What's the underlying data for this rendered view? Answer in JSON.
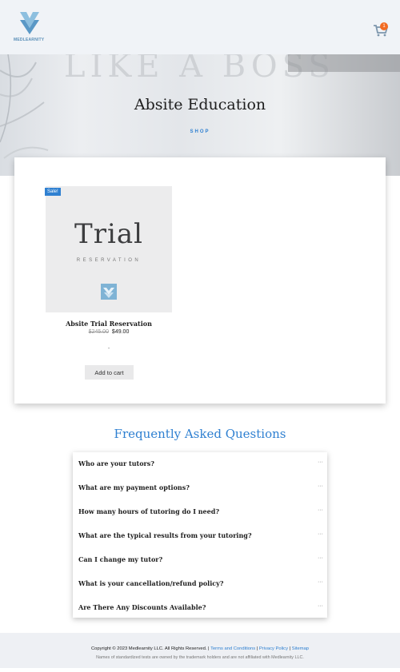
{
  "header": {
    "logo_text": "MEDLEARNITY",
    "cart_count": "1",
    "cart_icon": "shopping-cart-icon",
    "logo_icon": "medlearnity-logo-icon"
  },
  "hero": {
    "background_text": "LIKE A BOSS",
    "title": "Absite Education",
    "breadcrumb": "SHOP"
  },
  "product": {
    "sale_badge": "Sale!",
    "image_title": "Trial",
    "image_subtitle": "RESERVATION",
    "name": "Absite Trial Reservation",
    "old_price": "$245.00",
    "price": "$49.00",
    "separator": "-",
    "add_to_cart": "Add to cart"
  },
  "faq": {
    "title": "Frequently Asked Questions",
    "toggle_glyph": "···",
    "items": [
      {
        "question": "Who are your tutors?"
      },
      {
        "question": "What are my payment options?"
      },
      {
        "question": "How many hours of tutoring do I need?"
      },
      {
        "question": "What are the typical results from your tutoring?"
      },
      {
        "question": "Can I change my tutor?"
      },
      {
        "question": "What is your cancellation/refund policy?"
      },
      {
        "question": "Are There Any Discounts Available?"
      }
    ]
  },
  "footer": {
    "copyright": "Copyright © 2023 Medlearnity LLC. All Rights Reserved.",
    "sep": "|",
    "terms": "Terms and Conditions",
    "privacy": "Privacy Policy",
    "sitemap": "Sitemap",
    "disclaimer": "Names of standardized tests are owned by the trademark holders and are not affiliated with Medlearnity LLC."
  },
  "colors": {
    "accent": "#2f80d1",
    "badge": "#f26a21",
    "logo": "#7fb3d5"
  }
}
